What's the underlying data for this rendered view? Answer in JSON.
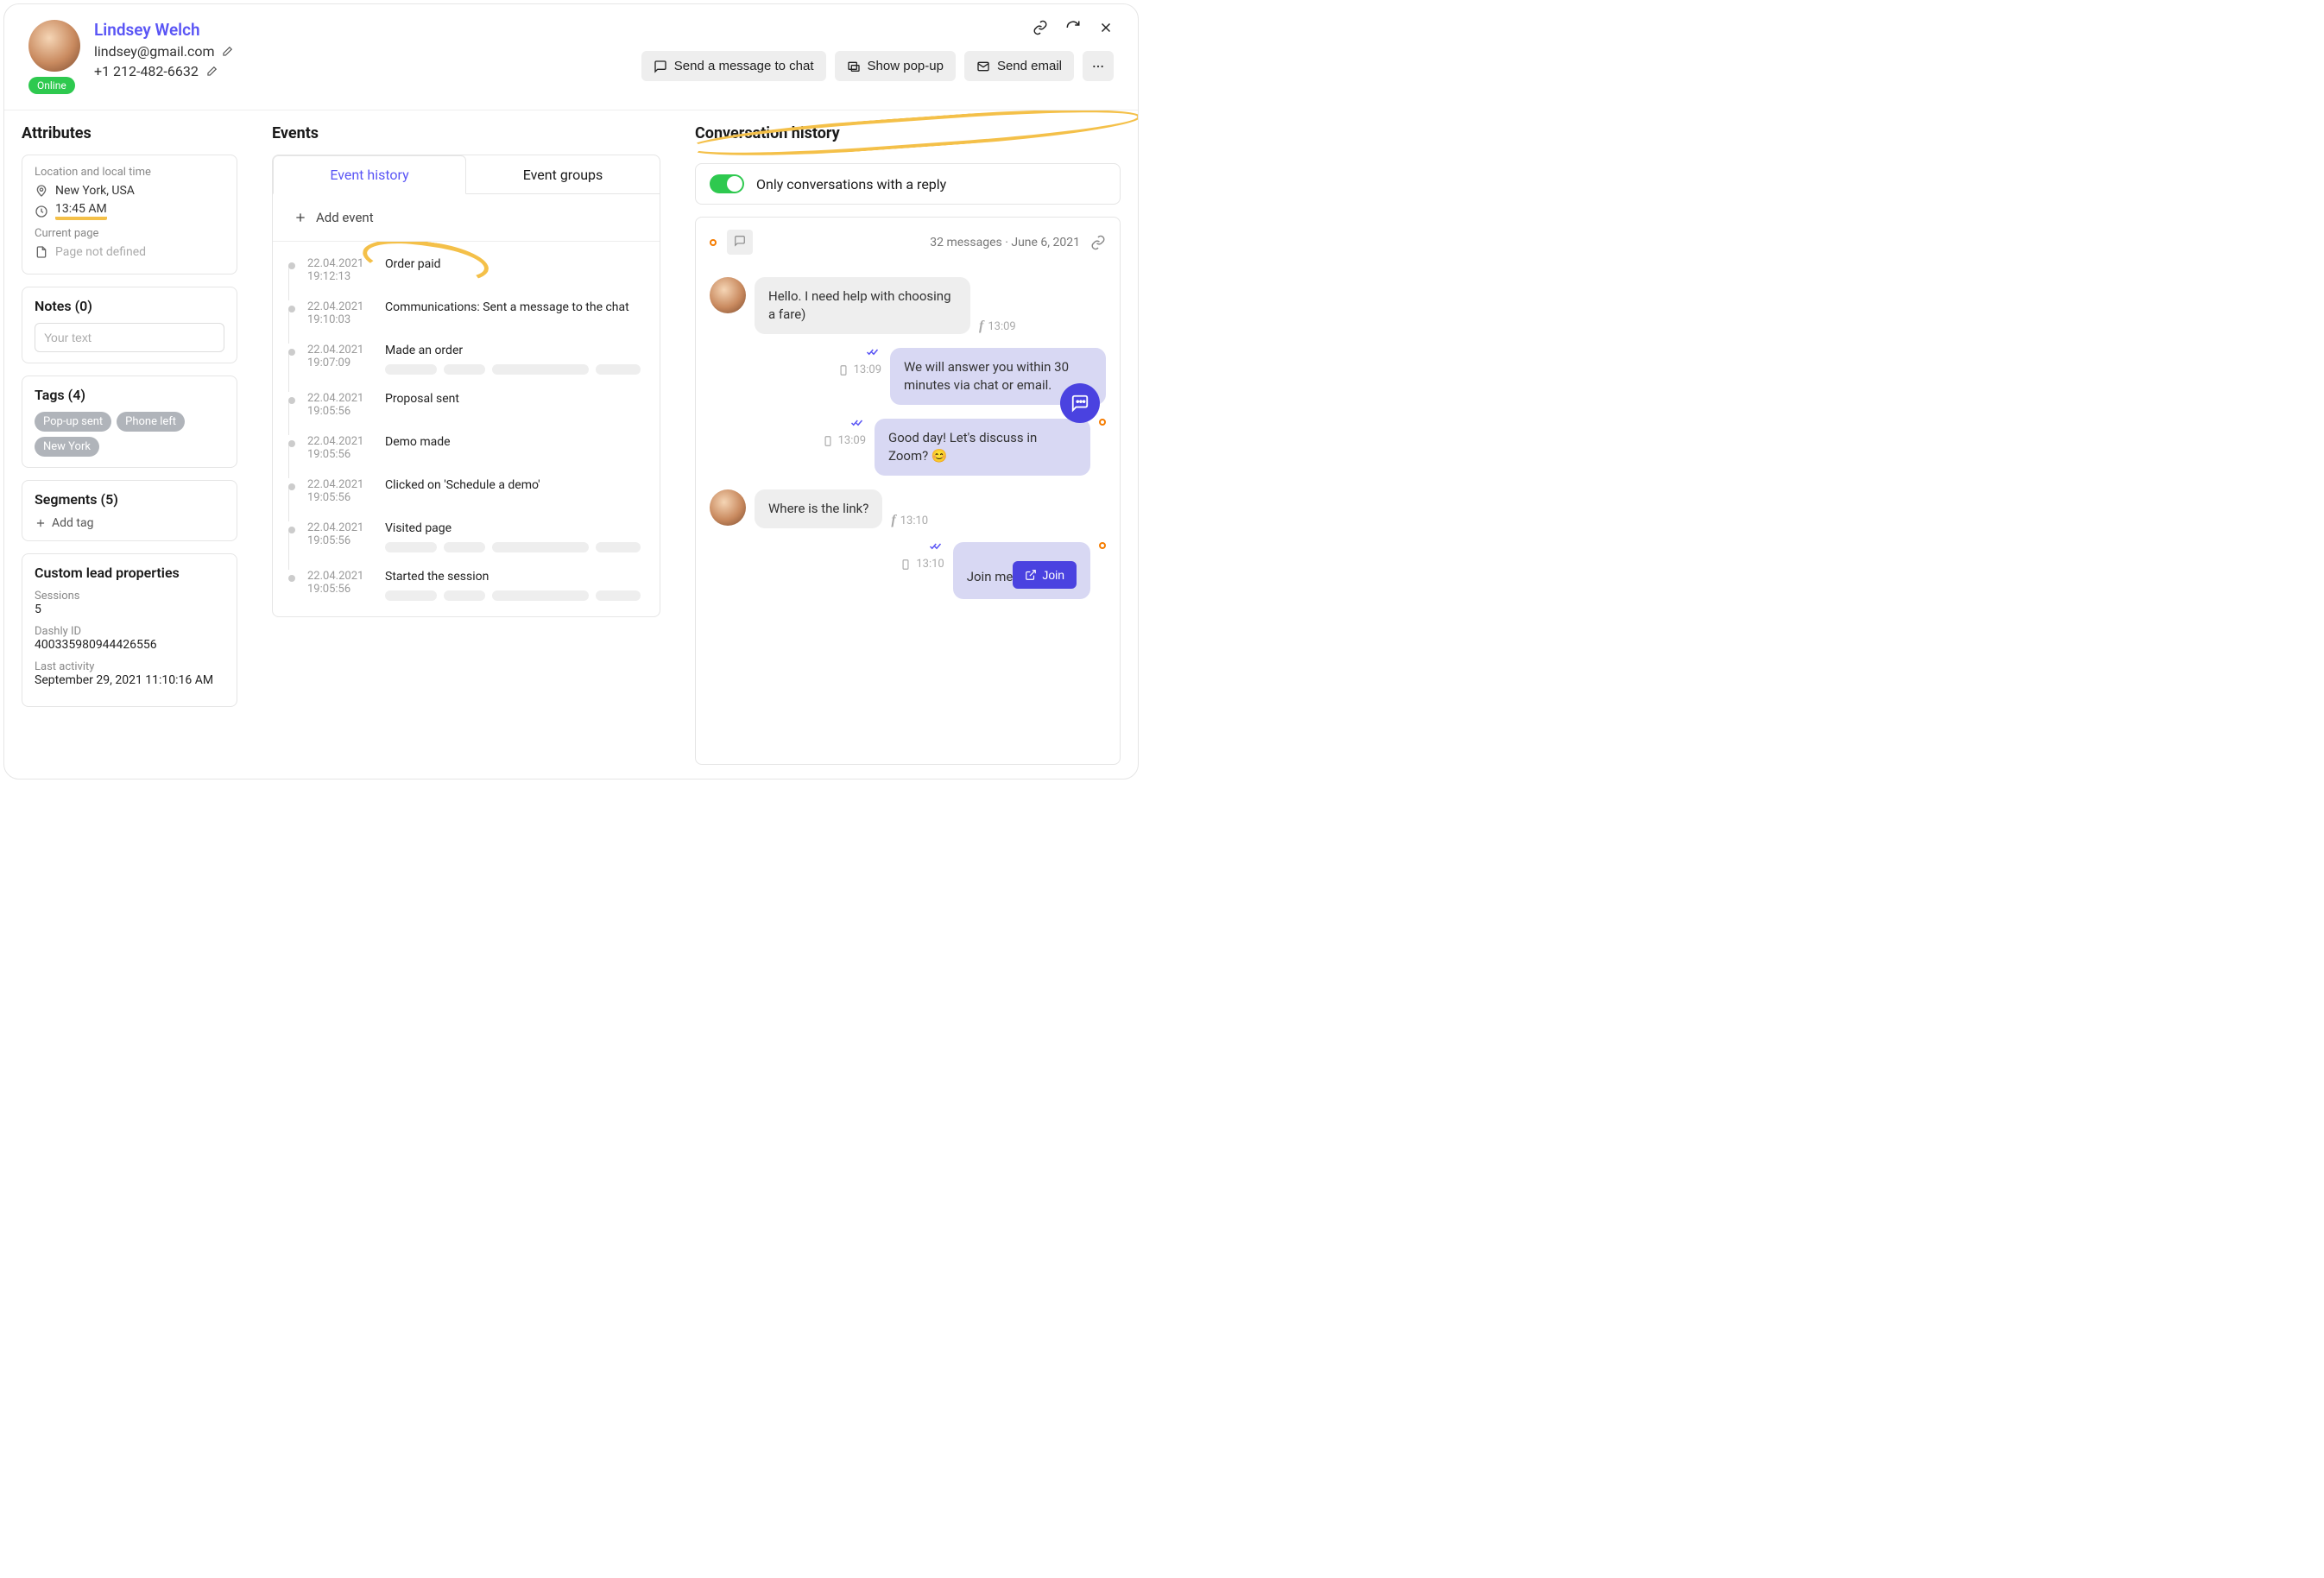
{
  "header": {
    "user_name": "Lindsey Welch",
    "user_email": "lindsey@gmail.com",
    "user_phone": "+1 212-482-6632",
    "status": "Online",
    "actions": {
      "send_chat": "Send a message to chat",
      "show_popup": "Show pop-up",
      "send_email": "Send email"
    }
  },
  "attributes": {
    "title": "Attributes",
    "location_label": "Location and local time",
    "location": "New York, USA",
    "local_time": "13:45 AM",
    "current_page_label": "Current page",
    "current_page": "Page not defined",
    "notes_title": "Notes (0)",
    "notes_placeholder": "Your text",
    "tags_title": "Tags (4)",
    "tags": [
      "Pop-up sent",
      "Phone left",
      "New York"
    ],
    "segments_title": "Segments (5)",
    "add_tag": "Add tag",
    "custom_title": "Custom lead properties",
    "sessions_k": "Sessions",
    "sessions_v": "5",
    "dashly_k": "Dashly ID",
    "dashly_v": "400335980944426556",
    "lastact_k": "Last activity",
    "lastact_v": "September 29, 2021 11:10:16 AM"
  },
  "events": {
    "title": "Events",
    "tab_history": "Event history",
    "tab_groups": "Event groups",
    "add_event": "Add event",
    "list": [
      {
        "date": "22.04.2021",
        "time": "19:12:13",
        "name": "Order paid",
        "annot": true
      },
      {
        "date": "22.04.2021",
        "time": "19:10:03",
        "name": "Communications: Sent a message to the chat"
      },
      {
        "date": "22.04.2021",
        "time": "19:07:09",
        "name": "Made an order",
        "pills": true
      },
      {
        "date": "22.04.2021",
        "time": "19:05:56",
        "name": "Proposal sent"
      },
      {
        "date": "22.04.2021",
        "time": "19:05:56",
        "name": "Demo made"
      },
      {
        "date": "22.04.2021",
        "time": "19:05:56",
        "name": "Clicked on 'Schedule a demo'"
      },
      {
        "date": "22.04.2021",
        "time": "19:05:56",
        "name": "Visited page",
        "pills": true
      },
      {
        "date": "22.04.2021",
        "time": "19:05:56",
        "name": "Started the session",
        "pills": true
      }
    ]
  },
  "conversation": {
    "title": "Conversation history",
    "filter_label": "Only conversations with a reply",
    "meta": "32 messages · June 6, 2021",
    "messages": [
      {
        "side": "in",
        "text": "Hello. I need help with choosing a fare)",
        "time": "13:09",
        "via": "f"
      },
      {
        "side": "out",
        "text": "We will answer you within 30 minutes via chat or email.",
        "time": "13:09",
        "via": "phone"
      },
      {
        "side": "out",
        "text": "Good day! Let's discuss in Zoom? 😊",
        "time": "13:09",
        "via": "phone",
        "avatar": "agent"
      },
      {
        "side": "in",
        "text": "Where is the link?",
        "time": "13:10",
        "via": "f"
      },
      {
        "side": "out",
        "text": "Join me",
        "time": "13:10",
        "via": "phone",
        "avatar": "agent",
        "join": true
      }
    ],
    "join_label": "Join"
  }
}
